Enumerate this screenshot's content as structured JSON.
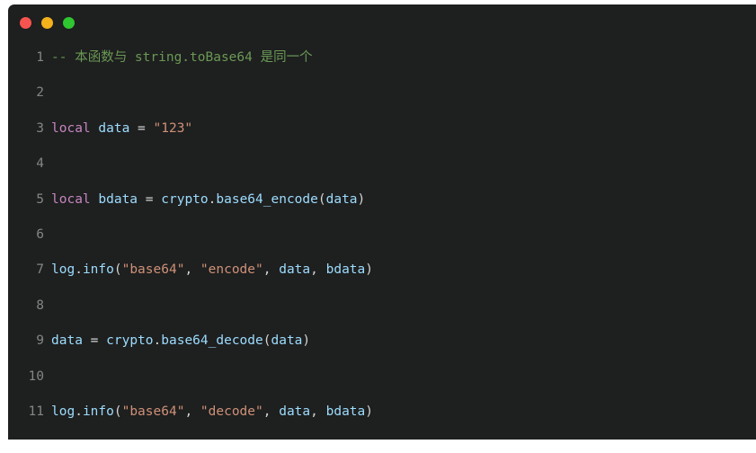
{
  "window": {
    "controls": [
      {
        "name": "close",
        "label": "Close",
        "color": "#f7544f"
      },
      {
        "name": "minimize",
        "label": "Minimize",
        "color": "#f3b21c"
      },
      {
        "name": "zoom",
        "label": "Zoom",
        "color": "#2fc731"
      }
    ]
  },
  "editor": {
    "language": "lua",
    "background": "#1e1f1f",
    "gutter_color": "#858585",
    "palette": {
      "comment": "#6a9955",
      "keyword": "#c586c0",
      "variable": "#9cdcfe",
      "function": "#9cdcfe",
      "string": "#ce9178",
      "punctuation": "#d4d4d4"
    },
    "lines": [
      {
        "number": "1",
        "text": "-- 本函数与 string.toBase64 是同一个",
        "tokens": [
          {
            "t": "-- 本函数与 string.toBase64 是同一个",
            "c": "tok-comment"
          }
        ]
      },
      {
        "number": "2",
        "text": "",
        "tokens": []
      },
      {
        "number": "3",
        "text": "local data = \"123\"",
        "tokens": [
          {
            "t": "local",
            "c": "tok-keyword"
          },
          {
            "t": " ",
            "c": "tok-plain"
          },
          {
            "t": "data",
            "c": "tok-var"
          },
          {
            "t": " ",
            "c": "tok-plain"
          },
          {
            "t": "=",
            "c": "tok-op"
          },
          {
            "t": " ",
            "c": "tok-plain"
          },
          {
            "t": "\"123\"",
            "c": "tok-string"
          }
        ]
      },
      {
        "number": "4",
        "text": "",
        "tokens": []
      },
      {
        "number": "5",
        "text": "local bdata = crypto.base64_encode(data)",
        "tokens": [
          {
            "t": "local",
            "c": "tok-keyword"
          },
          {
            "t": " ",
            "c": "tok-plain"
          },
          {
            "t": "bdata",
            "c": "tok-var"
          },
          {
            "t": " ",
            "c": "tok-plain"
          },
          {
            "t": "=",
            "c": "tok-op"
          },
          {
            "t": " ",
            "c": "tok-plain"
          },
          {
            "t": "crypto",
            "c": "tok-var"
          },
          {
            "t": ".",
            "c": "tok-punct"
          },
          {
            "t": "base64_encode",
            "c": "tok-func"
          },
          {
            "t": "(",
            "c": "tok-punct"
          },
          {
            "t": "data",
            "c": "tok-var"
          },
          {
            "t": ")",
            "c": "tok-punct"
          }
        ]
      },
      {
        "number": "6",
        "text": "",
        "tokens": []
      },
      {
        "number": "7",
        "text": "log.info(\"base64\", \"encode\", data, bdata)",
        "tokens": [
          {
            "t": "log",
            "c": "tok-var"
          },
          {
            "t": ".",
            "c": "tok-punct"
          },
          {
            "t": "info",
            "c": "tok-func"
          },
          {
            "t": "(",
            "c": "tok-punct"
          },
          {
            "t": "\"base64\"",
            "c": "tok-string"
          },
          {
            "t": ", ",
            "c": "tok-punct"
          },
          {
            "t": "\"encode\"",
            "c": "tok-string"
          },
          {
            "t": ", ",
            "c": "tok-punct"
          },
          {
            "t": "data",
            "c": "tok-var"
          },
          {
            "t": ", ",
            "c": "tok-punct"
          },
          {
            "t": "bdata",
            "c": "tok-var"
          },
          {
            "t": ")",
            "c": "tok-punct"
          }
        ]
      },
      {
        "number": "8",
        "text": "",
        "tokens": []
      },
      {
        "number": "9",
        "text": "data = crypto.base64_decode(data)",
        "tokens": [
          {
            "t": "data",
            "c": "tok-var"
          },
          {
            "t": " ",
            "c": "tok-plain"
          },
          {
            "t": "=",
            "c": "tok-op"
          },
          {
            "t": " ",
            "c": "tok-plain"
          },
          {
            "t": "crypto",
            "c": "tok-var"
          },
          {
            "t": ".",
            "c": "tok-punct"
          },
          {
            "t": "base64_decode",
            "c": "tok-func"
          },
          {
            "t": "(",
            "c": "tok-punct"
          },
          {
            "t": "data",
            "c": "tok-var"
          },
          {
            "t": ")",
            "c": "tok-punct"
          }
        ]
      },
      {
        "number": "10",
        "text": "",
        "tokens": []
      },
      {
        "number": "11",
        "text": "log.info(\"base64\", \"decode\", data, bdata)",
        "tokens": [
          {
            "t": "log",
            "c": "tok-var"
          },
          {
            "t": ".",
            "c": "tok-punct"
          },
          {
            "t": "info",
            "c": "tok-func"
          },
          {
            "t": "(",
            "c": "tok-punct"
          },
          {
            "t": "\"base64\"",
            "c": "tok-string"
          },
          {
            "t": ", ",
            "c": "tok-punct"
          },
          {
            "t": "\"decode\"",
            "c": "tok-string"
          },
          {
            "t": ", ",
            "c": "tok-punct"
          },
          {
            "t": "data",
            "c": "tok-var"
          },
          {
            "t": ", ",
            "c": "tok-punct"
          },
          {
            "t": "bdata",
            "c": "tok-var"
          },
          {
            "t": ")",
            "c": "tok-punct"
          }
        ]
      }
    ]
  }
}
